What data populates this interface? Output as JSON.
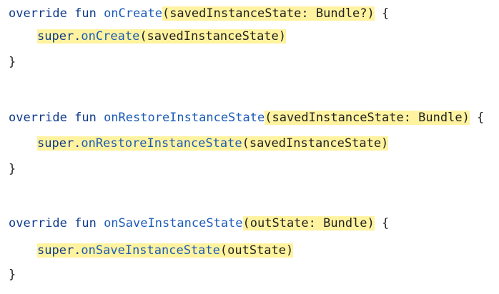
{
  "code": {
    "block1": {
      "kw": "override fun ",
      "fn": "onCreate",
      "params": "(savedInstanceState: Bundle?)",
      "brace": " {",
      "body_kw": "super.",
      "body_fn": "onCreate",
      "body_args": "(savedInstanceState)",
      "close": "}"
    },
    "block2": {
      "kw": "override fun ",
      "fn": "onRestoreInstanceState",
      "params": "(savedInstanceState: Bundle)",
      "brace": " {",
      "body_kw": "super.",
      "body_fn": "onRestoreInstanceState",
      "body_args": "(savedInstanceState)",
      "close": "}"
    },
    "block3": {
      "kw": "override fun ",
      "fn": "onSaveInstanceState",
      "params": "(outState: Bundle)",
      "brace": " {",
      "body_kw": "super.",
      "body_fn": "onSaveInstanceState",
      "body_args": "(outState)",
      "close": "}"
    }
  },
  "colors": {
    "keyword": "#0f3a8c",
    "function": "#1b5bb8",
    "highlight": "#fff3a0",
    "text": "#222222"
  }
}
